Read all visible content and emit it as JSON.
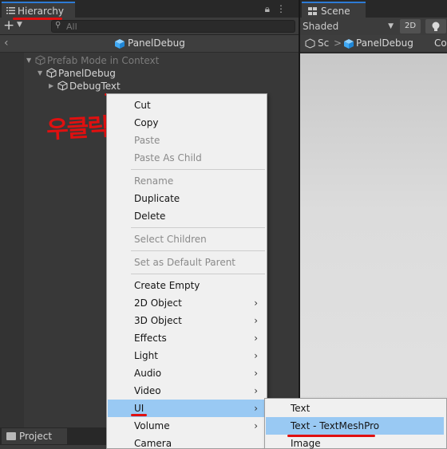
{
  "hierarchy": {
    "tab_label": "Hierarchy",
    "search_placeholder": "All",
    "breadcrumb_title": "PanelDebug",
    "tree": [
      {
        "label": "Prefab Mode in Context"
      },
      {
        "label": "PanelDebug"
      },
      {
        "label": "DebugText"
      }
    ]
  },
  "annotation": {
    "text": "우클릭",
    "color": "#e01010"
  },
  "scene": {
    "tab_label": "Scene",
    "shading_mode": "Shaded",
    "btn_2d": "2D",
    "breadcrumb_scene": "Sc",
    "breadcrumb_separator": ">",
    "breadcrumb_prefab": "PanelDebug",
    "breadcrumb_context": "Co"
  },
  "project": {
    "tab_label": "Project"
  },
  "context_menu": {
    "cut": "Cut",
    "copy": "Copy",
    "paste": "Paste",
    "paste_as_child": "Paste As Child",
    "rename": "Rename",
    "duplicate": "Duplicate",
    "delete": "Delete",
    "select_children": "Select Children",
    "set_default_parent": "Set as Default Parent",
    "create_empty": "Create Empty",
    "object_2d": "2D Object",
    "object_3d": "3D Object",
    "effects": "Effects",
    "light": "Light",
    "audio": "Audio",
    "video": "Video",
    "ui": "UI",
    "volume": "Volume",
    "camera": "Camera",
    "submenu_arrow": "›"
  },
  "ui_submenu": {
    "text": "Text",
    "text_tmp": "Text - TextMeshPro",
    "image": "Image"
  },
  "colors": {
    "accent": "#2d7bd6",
    "menu_highlight": "#99c9f3",
    "annotation_red": "#e01010",
    "prefab_blue": "#3fa9f5"
  }
}
